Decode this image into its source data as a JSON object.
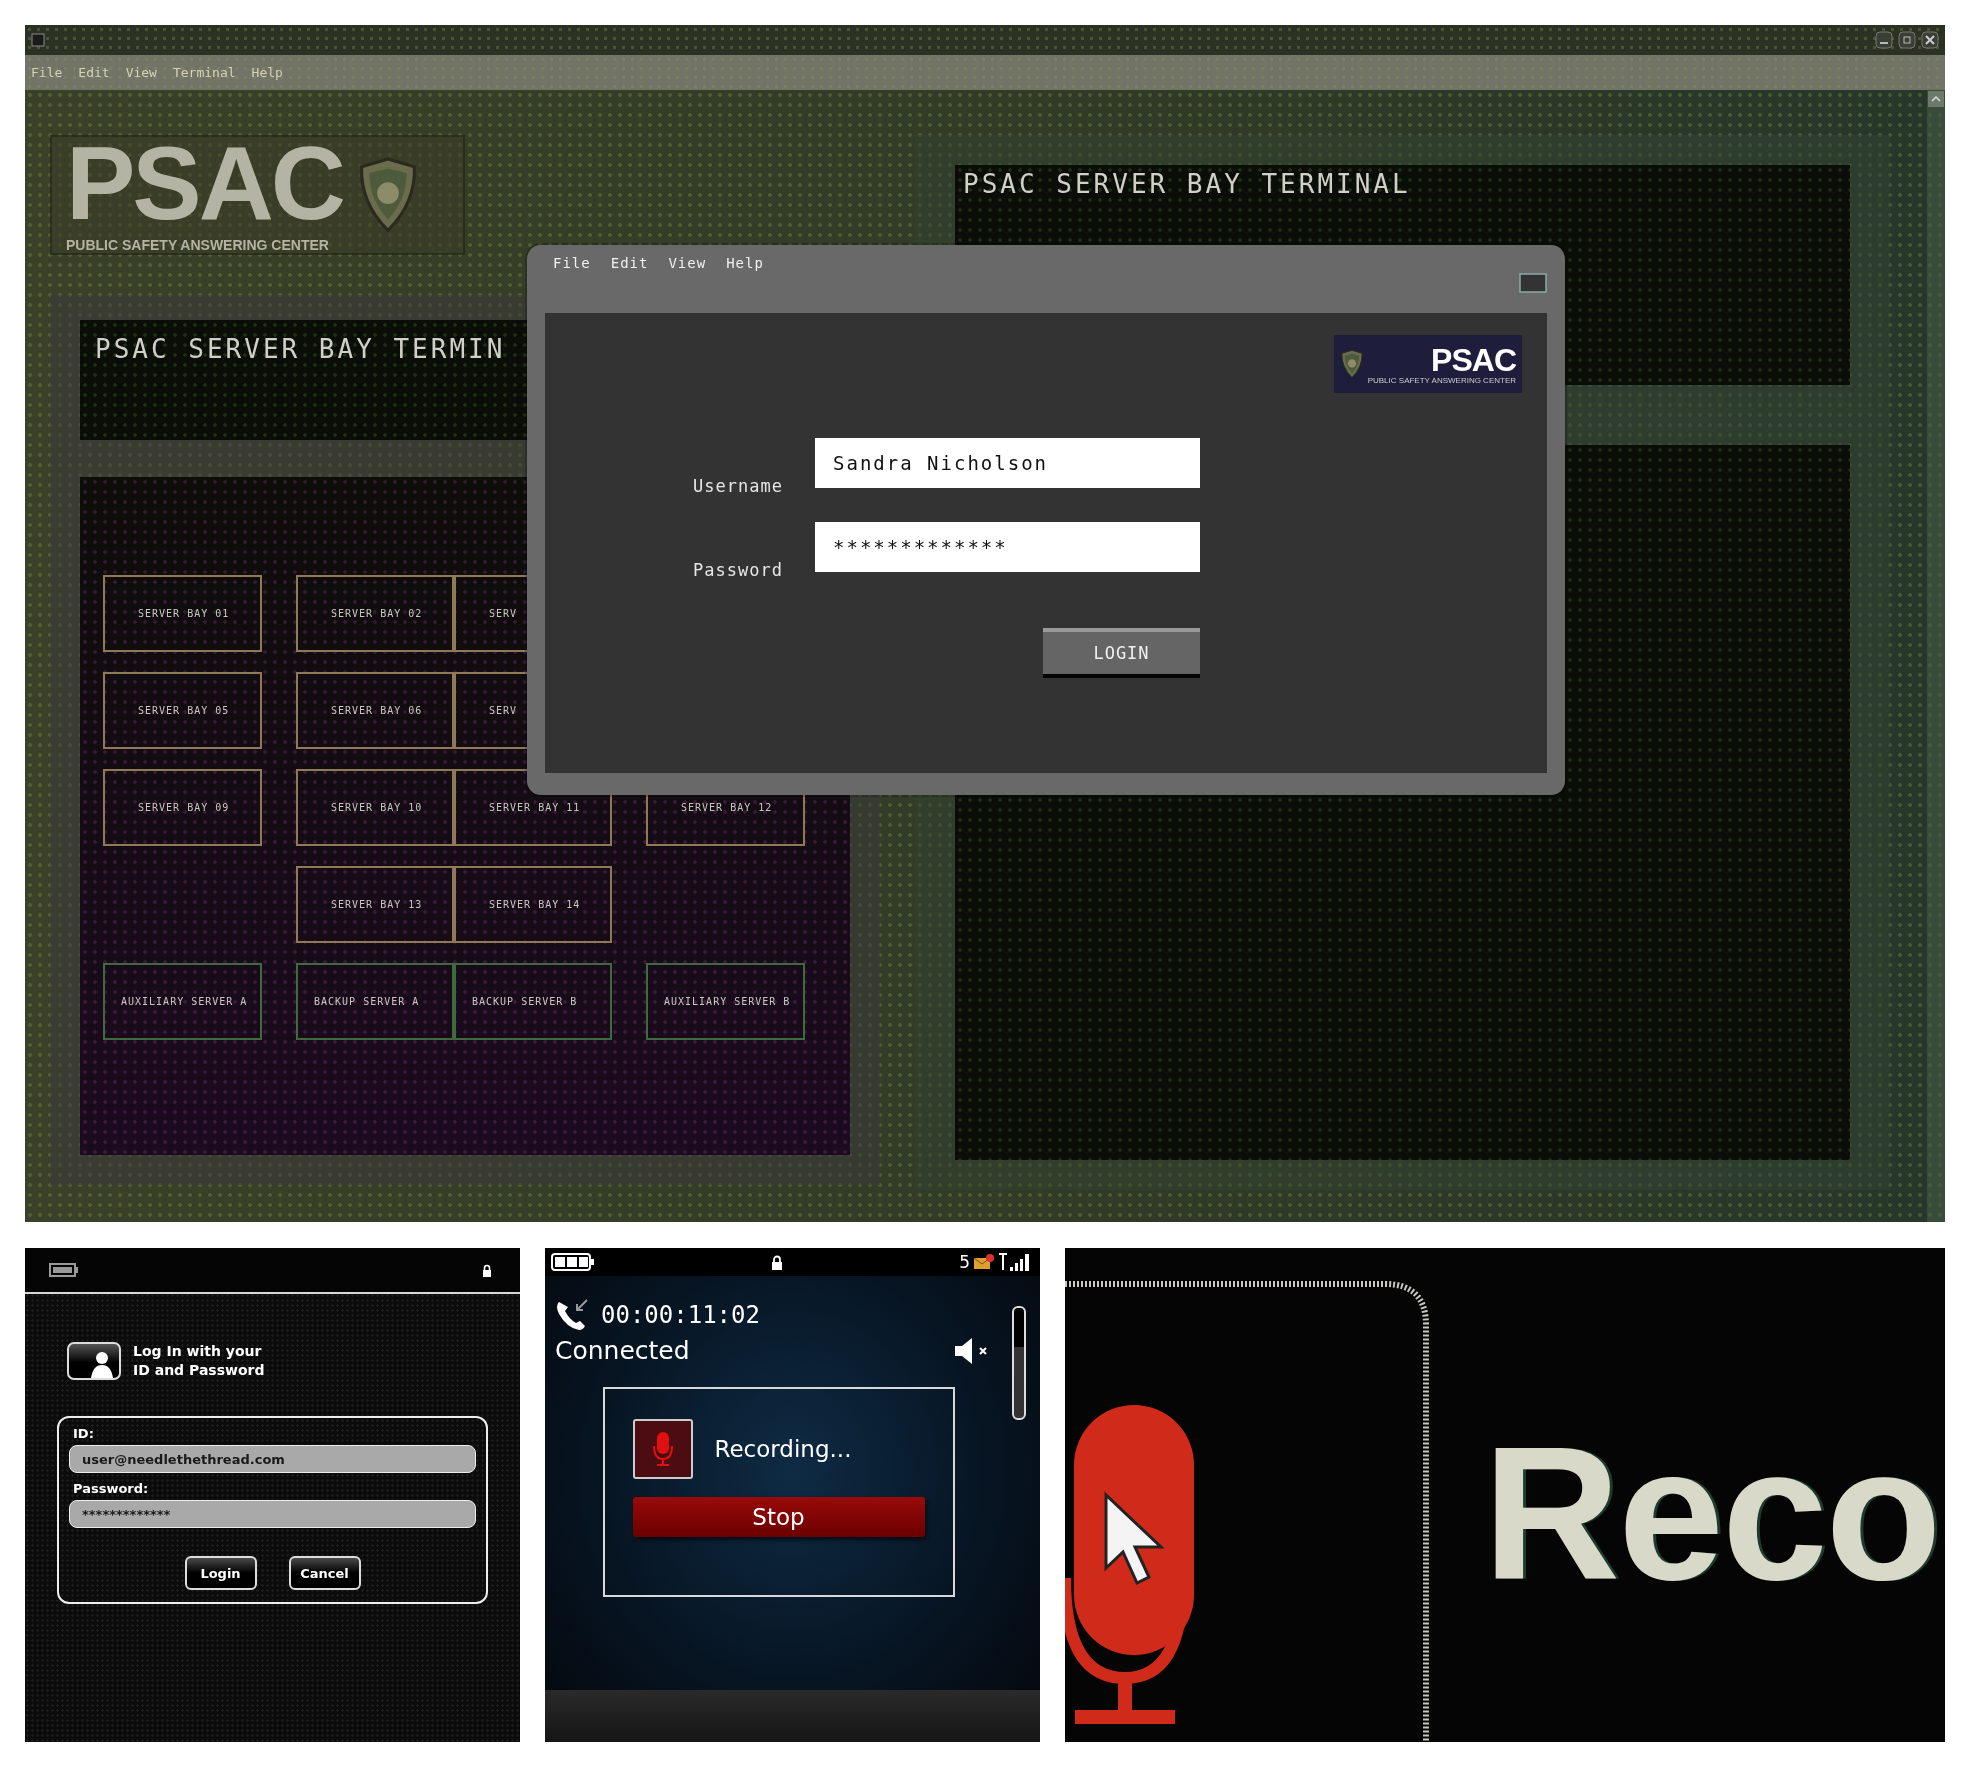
{
  "desktop_window": {
    "menu": [
      "File",
      "Edit",
      "View",
      "Terminal",
      "Help"
    ]
  },
  "logo": {
    "title": "PSAC",
    "subtitle": "PUBLIC SAFETY ANSWERING CENTER"
  },
  "left_terminal": {
    "title": "PSAC SERVER BAY TERMIN",
    "rows": [
      {
        "cells": [
          {
            "label": "SERVER BAY 01",
            "kind": "bay"
          },
          {
            "label": "SERVER BAY 02",
            "kind": "bay"
          },
          {
            "label": "SERV",
            "kind": "bay"
          }
        ]
      },
      {
        "cells": [
          {
            "label": "SERVER BAY 05",
            "kind": "bay"
          },
          {
            "label": "SERVER BAY 06",
            "kind": "bay"
          },
          {
            "label": "SERV",
            "kind": "bay"
          }
        ]
      },
      {
        "cells": [
          {
            "label": "SERVER BAY 09",
            "kind": "bay"
          },
          {
            "label": "SERVER BAY 10",
            "kind": "bay"
          },
          {
            "label": "SERVER BAY 11",
            "kind": "bay"
          },
          {
            "label": "SERVER BAY 12",
            "kind": "bay"
          }
        ]
      },
      {
        "cells": [
          {
            "kind": "empty"
          },
          {
            "label": "SERVER BAY 13",
            "kind": "bay"
          },
          {
            "label": "SERVER BAY 14",
            "kind": "bay"
          }
        ]
      },
      {
        "cells": [
          {
            "label": "AUXILIARY SERVER A",
            "kind": "server"
          },
          {
            "label": "BACKUP SERVER A",
            "kind": "server"
          },
          {
            "label": "BACKUP SERVER B",
            "kind": "server"
          },
          {
            "label": "AUXILIARY SERVER B",
            "kind": "server"
          }
        ]
      }
    ]
  },
  "right_terminal": {
    "title": "PSAC SERVER BAY TERMINAL"
  },
  "login_dialog": {
    "menu": [
      "File",
      "Edit",
      "View",
      "Help"
    ],
    "logo": {
      "title": "PSAC",
      "subtitle": "PUBLIC SAFETY ANSWERING CENTER"
    },
    "username": {
      "label": "Username",
      "value": "Sandra Nicholson"
    },
    "password": {
      "label": "Password",
      "value": "*************"
    },
    "button": "LOGIN"
  },
  "phone_login": {
    "heading": "Log In with your ID and Password",
    "id_label": "ID:",
    "id_value": "user@needlethethread.com",
    "password_label": "Password:",
    "password_value": "*************",
    "buttons": [
      "Login",
      "Cancel"
    ]
  },
  "call_screen": {
    "message_count": "5",
    "timer": "00:00:11:02",
    "status": "Connected",
    "recording_label": "Recording...",
    "stop_button": "Stop"
  },
  "closeup": {
    "text": "Reco"
  }
}
